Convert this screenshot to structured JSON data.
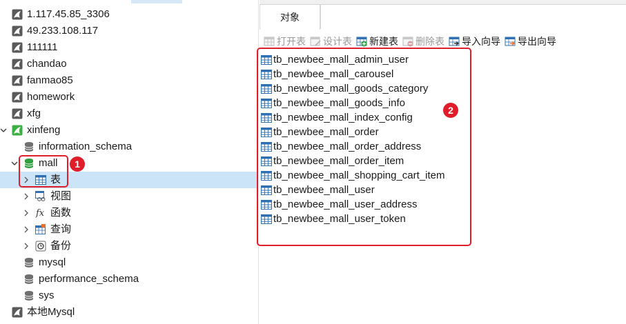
{
  "tree": {
    "connections": [
      {
        "label": "1.117.45.85_3306"
      },
      {
        "label": "49.233.108.117"
      },
      {
        "label": "111111"
      },
      {
        "label": "chandao"
      },
      {
        "label": "fanmao85"
      },
      {
        "label": "homework"
      },
      {
        "label": "xfg"
      },
      {
        "label": "xinfeng"
      }
    ],
    "databases": [
      {
        "label": "information_schema"
      },
      {
        "label": "mall"
      }
    ],
    "mall_children": [
      {
        "label": "表",
        "icon": "table-icon"
      },
      {
        "label": "视图",
        "icon": "view-icon"
      },
      {
        "label": "函数",
        "icon": "function-icon"
      },
      {
        "label": "查询",
        "icon": "query-icon"
      },
      {
        "label": "备份",
        "icon": "backup-icon"
      }
    ],
    "more_databases": [
      {
        "label": "mysql"
      },
      {
        "label": "performance_schema"
      },
      {
        "label": "sys"
      }
    ],
    "local_connection": {
      "label": "本地Mysql"
    }
  },
  "tabs": {
    "object_tab": "对象"
  },
  "toolbar": {
    "open_table": "打开表",
    "design_table": "设计表",
    "new_table": "新建表",
    "delete_table": "删除表",
    "import_wizard": "导入向导",
    "export_wizard": "导出向导"
  },
  "tables": [
    "tb_newbee_mall_admin_user",
    "tb_newbee_mall_carousel",
    "tb_newbee_mall_goods_category",
    "tb_newbee_mall_goods_info",
    "tb_newbee_mall_index_config",
    "tb_newbee_mall_order",
    "tb_newbee_mall_order_address",
    "tb_newbee_mall_order_item",
    "tb_newbee_mall_shopping_cart_item",
    "tb_newbee_mall_user",
    "tb_newbee_mall_user_address",
    "tb_newbee_mall_user_token"
  ],
  "annotations": {
    "badge1": "1",
    "badge2": "2"
  },
  "colors": {
    "annotation_red": "#e01e2b",
    "selection_blue": "#cce4f7",
    "connection_green": "#3cb043"
  }
}
